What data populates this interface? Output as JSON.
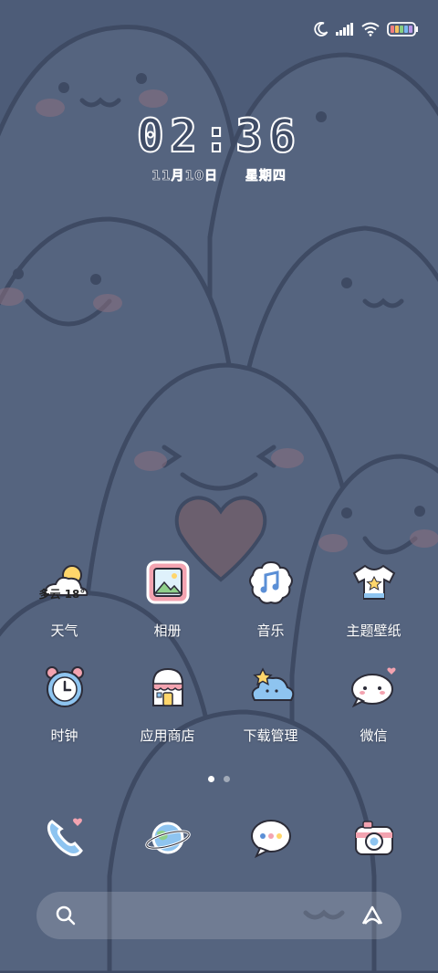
{
  "clock": {
    "time": "02:36",
    "date": "11月10日",
    "weekday": "星期四"
  },
  "weather": {
    "condition": "多云",
    "temp": "18°"
  },
  "apps": [
    {
      "label": "天气",
      "icon": "weather-icon"
    },
    {
      "label": "相册",
      "icon": "gallery-icon"
    },
    {
      "label": "音乐",
      "icon": "music-icon"
    },
    {
      "label": "主题壁纸",
      "icon": "themes-icon"
    },
    {
      "label": "时钟",
      "icon": "clock-icon"
    },
    {
      "label": "应用商店",
      "icon": "app-store-icon"
    },
    {
      "label": "下载管理",
      "icon": "downloads-icon"
    },
    {
      "label": "微信",
      "icon": "wechat-icon"
    }
  ],
  "dock": [
    {
      "icon": "phone-icon"
    },
    {
      "icon": "browser-planet-icon"
    },
    {
      "icon": "messages-icon"
    },
    {
      "icon": "camera-icon"
    }
  ],
  "colors": {
    "wallpaper": "#4d5c78",
    "blob": "#55647f",
    "outline": "#3e4a63",
    "heart": "#6b5f6e",
    "cheek": "#8a6f80"
  }
}
